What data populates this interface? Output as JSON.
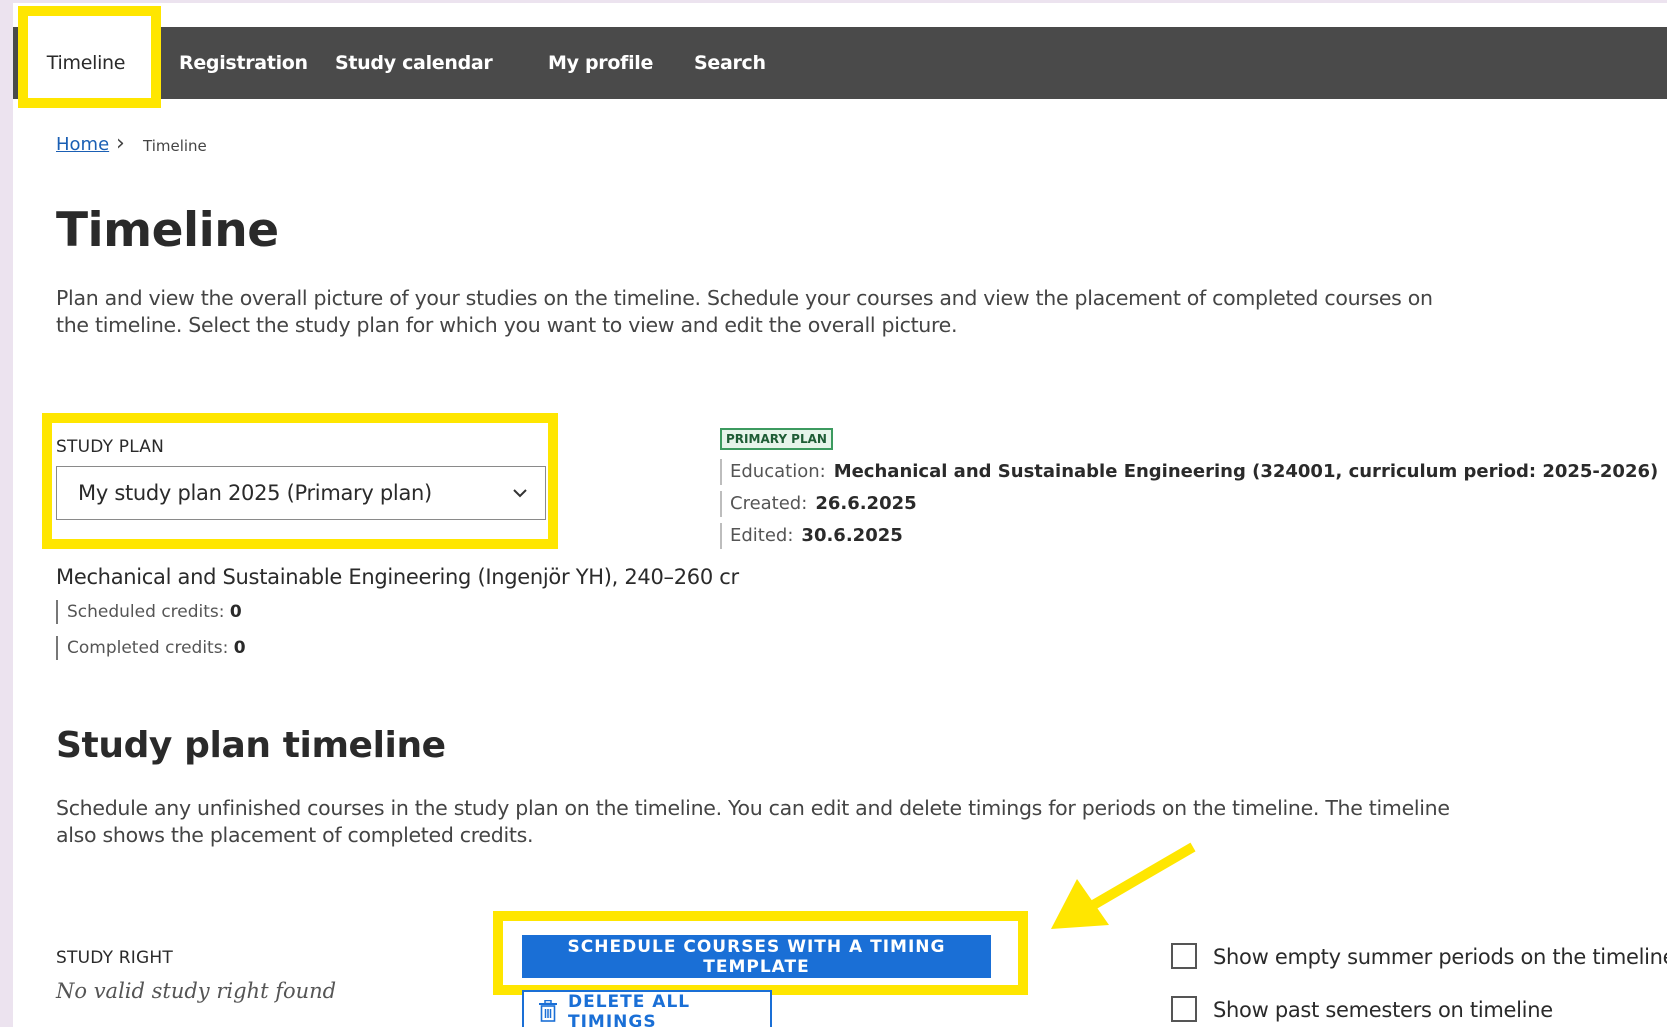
{
  "nav": {
    "items": [
      {
        "label": "Timeline"
      },
      {
        "label": "Registration"
      },
      {
        "label": "Study calendar"
      },
      {
        "label": "My profile"
      },
      {
        "label": "Search"
      }
    ]
  },
  "breadcrumb": {
    "home": "Home",
    "current": "Timeline"
  },
  "page": {
    "title": "Timeline",
    "intro": "Plan and view the overall picture of your studies on the timeline. Schedule your courses and view the placement of completed courses on the timeline. Select the study plan for which you want to view and edit the overall picture."
  },
  "study_plan": {
    "label": "STUDY PLAN",
    "selected": "My study plan 2025 (Primary plan)",
    "badge": "PRIMARY PLAN",
    "education_label": "Education:",
    "education_value": "Mechanical and Sustainable Engineering (324001, curriculum period: 2025-2026)",
    "created_label": "Created:",
    "created_value": "26.6.2025",
    "edited_label": "Edited:",
    "edited_value": "30.6.2025"
  },
  "education": {
    "title": "Mechanical and Sustainable Engineering (Ingenjör YH), 240–260 cr",
    "scheduled_label": "Scheduled credits:",
    "scheduled_value": "0",
    "completed_label": "Completed credits:",
    "completed_value": "0"
  },
  "timeline_section": {
    "title": "Study plan timeline",
    "intro": "Schedule any unfinished courses in the study plan on the timeline. You can edit and delete timings for periods on the timeline. The timeline also shows the placement of completed credits.",
    "study_right_label": "STUDY RIGHT",
    "study_right_value": "No valid study right found",
    "schedule_button": "SCHEDULE COURSES WITH A TIMING TEMPLATE",
    "delete_button": "DELETE ALL TIMINGS",
    "checkbox_summer": "Show empty summer periods on the timeline",
    "checkbox_past": "Show past semesters on timeline"
  },
  "colors": {
    "highlight": "#ffe600",
    "primary": "#1a6fd6",
    "nav_bg": "#4a4a4a"
  }
}
